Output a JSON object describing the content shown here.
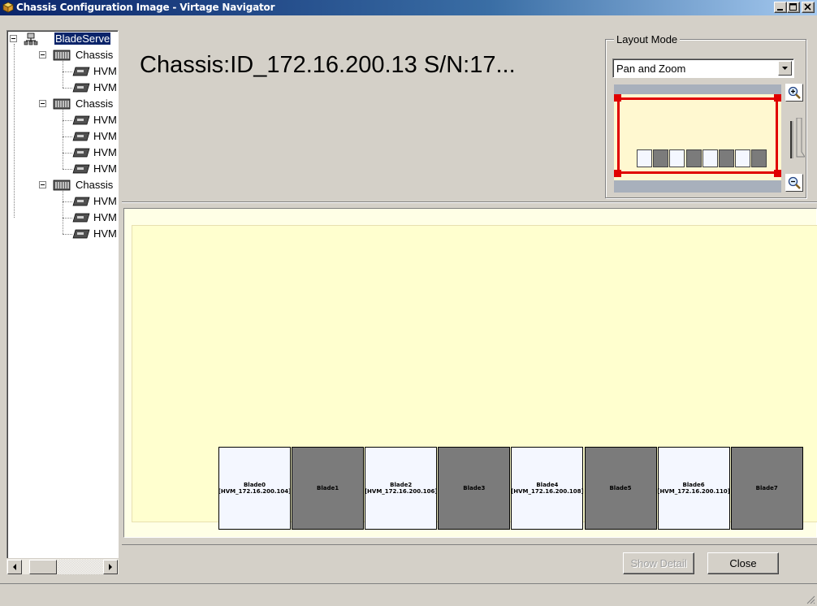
{
  "window": {
    "title": "Chassis Configuration Image - Virtage Navigator"
  },
  "tree": {
    "root": "BladeServe",
    "chassis": [
      {
        "label": "Chassis",
        "children": [
          "HVM",
          "HVM"
        ]
      },
      {
        "label": "Chassis",
        "children": [
          "HVM",
          "HVM",
          "HVM",
          "HVM"
        ]
      },
      {
        "label": "Chassis",
        "children": [
          "HVM",
          "HVM",
          "HVM"
        ]
      }
    ]
  },
  "header": {
    "chassis_title": "Chassis:ID_172.16.200.13 S/N:17..."
  },
  "layout_mode": {
    "legend": "Layout Mode",
    "selected": "Pan and Zoom"
  },
  "blades": [
    {
      "label": "Blade0 [HVM_172.16.200.104]",
      "state": "assigned"
    },
    {
      "label": "Blade1",
      "state": "empty"
    },
    {
      "label": "Blade2 [HVM_172.16.200.106]",
      "state": "assigned"
    },
    {
      "label": "Blade3",
      "state": "empty"
    },
    {
      "label": "Blade4 [HVM_172.16.200.108]",
      "state": "assigned"
    },
    {
      "label": "Blade5",
      "state": "empty"
    },
    {
      "label": "Blade6 [HVM_172.16.200.110]",
      "state": "assigned"
    },
    {
      "label": "Blade7",
      "state": "empty"
    }
  ],
  "buttons": {
    "show_detail": "Show Detail",
    "close": "Close"
  },
  "colors": {
    "title_bar": "#0a246a",
    "canvas": "#ffffcf",
    "blade_assigned": "#f4f7ff",
    "blade_empty": "#7b7b7b",
    "viewport_frame": "#e00000"
  }
}
